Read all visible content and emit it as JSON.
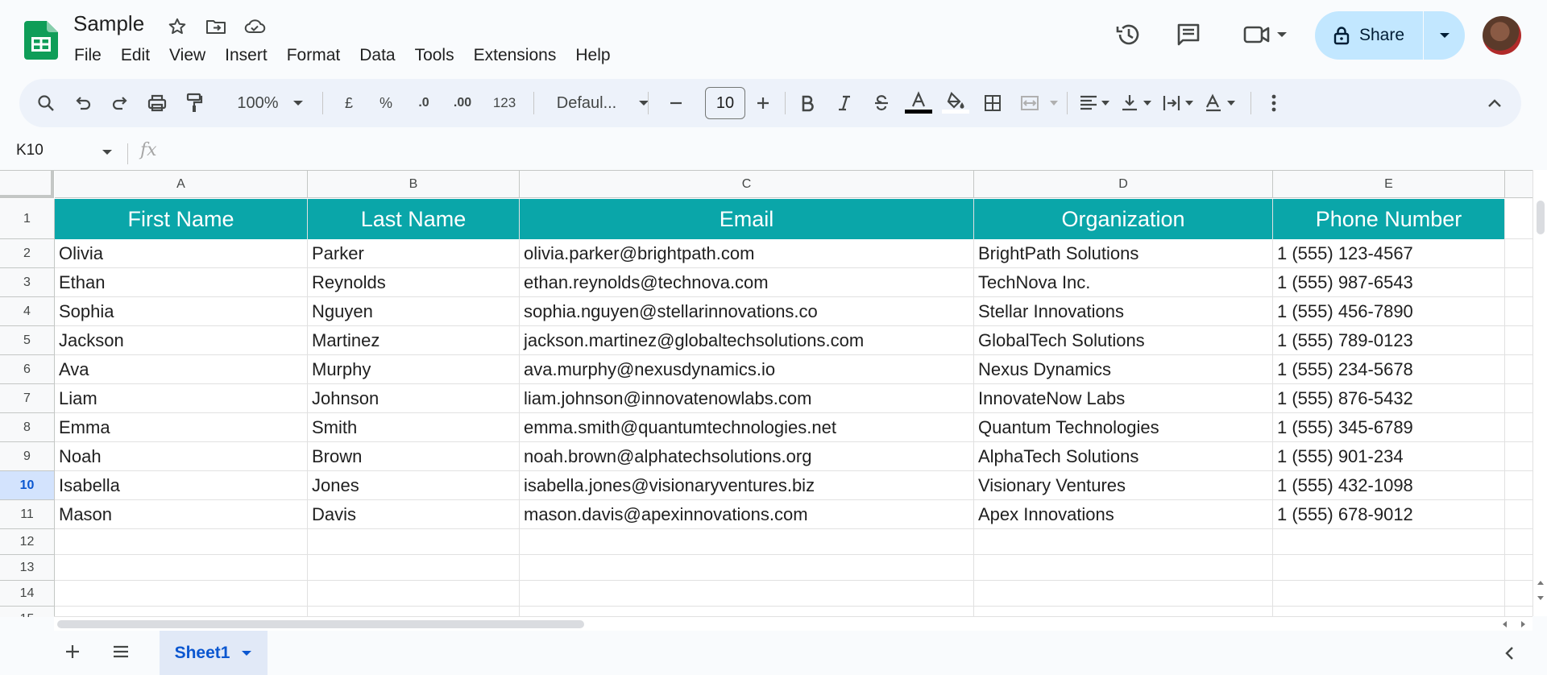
{
  "app": {
    "title": "Sample"
  },
  "menu": [
    "File",
    "Edit",
    "View",
    "Insert",
    "Format",
    "Data",
    "Tools",
    "Extensions",
    "Help"
  ],
  "share": {
    "label": "Share"
  },
  "toolbar": {
    "zoom": "100%",
    "currency": "£",
    "percent": "%",
    "decrease_decimal": ".0",
    "increase_decimal": ".00",
    "number_format": "123",
    "font": "Defaul...",
    "font_size": "10"
  },
  "formula_bar": {
    "cell_ref": "K10",
    "fx": "fx"
  },
  "columns": [
    "A",
    "B",
    "C",
    "D",
    "E"
  ],
  "row_numbers": [
    "1",
    "2",
    "3",
    "4",
    "5",
    "6",
    "7",
    "8",
    "9",
    "10",
    "11",
    "12",
    "13",
    "14",
    "15"
  ],
  "selected_row": "10",
  "table": {
    "headers": [
      "First Name",
      "Last Name",
      "Email",
      "Organization",
      "Phone Number"
    ],
    "rows": [
      [
        "Olivia",
        "Parker",
        "olivia.parker@brightpath.com",
        "BrightPath Solutions",
        "1 (555) 123-4567"
      ],
      [
        "Ethan",
        "Reynolds",
        "ethan.reynolds@technova.com",
        "TechNova Inc.",
        "1 (555) 987-6543"
      ],
      [
        "Sophia",
        "Nguyen",
        "sophia.nguyen@stellarinnovations.co",
        "Stellar Innovations",
        "1 (555) 456-7890"
      ],
      [
        "Jackson",
        "Martinez",
        "jackson.martinez@globaltechsolutions.com",
        "GlobalTech Solutions",
        "1 (555) 789-0123"
      ],
      [
        "Ava",
        "Murphy",
        "ava.murphy@nexusdynamics.io",
        "Nexus Dynamics",
        "1 (555) 234-5678"
      ],
      [
        "Liam",
        "Johnson",
        "liam.johnson@innovatenowlabs.com",
        "InnovateNow Labs",
        "1 (555) 876-5432"
      ],
      [
        "Emma",
        "Smith",
        "emma.smith@quantumtechnologies.net",
        "Quantum Technologies",
        "1 (555) 345-6789"
      ],
      [
        "Noah",
        "Brown",
        "noah.brown@alphatechsolutions.org",
        "AlphaTech Solutions",
        "1 (555) 901-234"
      ],
      [
        "Isabella",
        "Jones",
        "isabella.jones@visionaryventures.biz",
        "Visionary Ventures",
        "1 (555) 432-1098"
      ],
      [
        "Mason",
        "Davis",
        "mason.davis@apexinnovations.com",
        "Apex Innovations",
        "1 (555) 678-9012"
      ]
    ]
  },
  "sheet_tab": {
    "label": "Sheet1"
  },
  "colors": {
    "header_fill": "#0aa6a9",
    "header_text": "#ffffff",
    "share_bg": "#c2e7ff",
    "selection": "#0b57d0"
  }
}
